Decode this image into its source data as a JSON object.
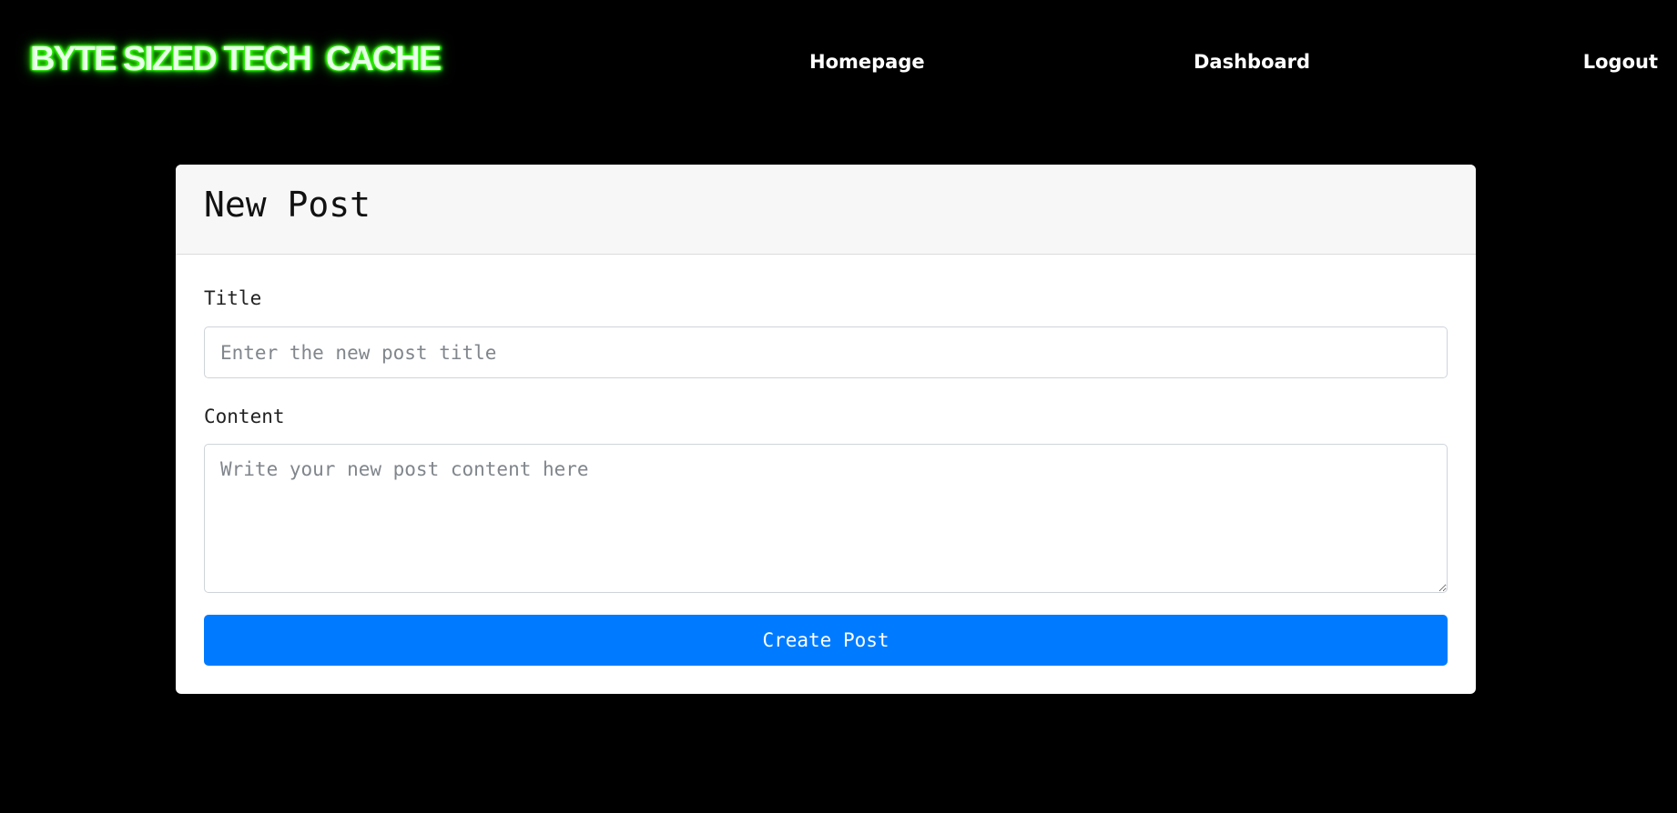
{
  "navbar": {
    "brand": "BYTE SIZED TECH  CACHE",
    "links": [
      {
        "label": "Homepage"
      },
      {
        "label": "Dashboard"
      },
      {
        "label": "Logout"
      }
    ]
  },
  "form": {
    "heading": "New Post",
    "title_label": "Title",
    "title_placeholder": "Enter the new post title",
    "title_value": "",
    "content_label": "Content",
    "content_placeholder": "Write your new post content here",
    "content_value": "",
    "submit_label": "Create Post"
  },
  "colors": {
    "background": "#000000",
    "brand_glow": "#39ff14",
    "primary_button": "#007bff",
    "card_header": "#f7f7f7"
  }
}
